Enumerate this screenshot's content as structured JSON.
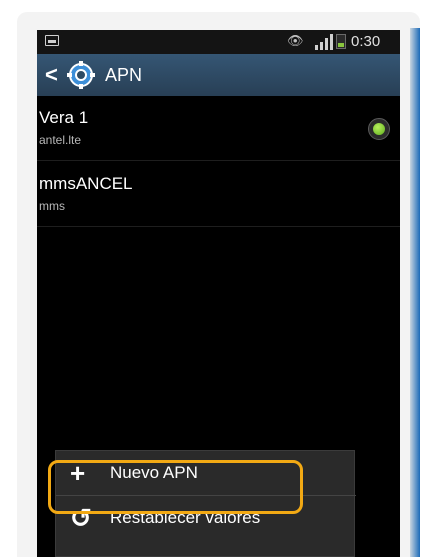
{
  "status": {
    "time": "0:30"
  },
  "actionbar": {
    "title": "APN"
  },
  "apns": [
    {
      "name": "Vera 1",
      "apn": "antel.lte",
      "selected": true
    },
    {
      "name": "mmsANCEL",
      "apn": "mms",
      "selected": false
    }
  ],
  "menu": {
    "items": [
      {
        "label": "Nuevo APN",
        "icon": "plus-icon"
      },
      {
        "label": "Restablecer valores",
        "icon": "reset-icon"
      }
    ]
  },
  "colors": {
    "actionbar": "#2e4b63",
    "highlight": "#f2a914",
    "radio_selected": "#7fd233"
  }
}
